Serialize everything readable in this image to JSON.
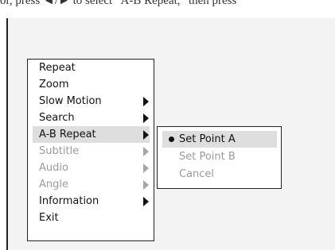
{
  "top_text": "or, press ◄/► to select “A-B Repeat,” then press",
  "main_menu": {
    "items": [
      {
        "label": "Repeat"
      },
      {
        "label": "Zoom"
      },
      {
        "label": "Slow Motion",
        "arrow_icon": "triangle-right"
      },
      {
        "label": "Search",
        "arrow_icon": "triangle-right"
      },
      {
        "label": "A-B Repeat",
        "arrow_icon": "triangle-right",
        "state": "selected"
      },
      {
        "label": "Subtitle",
        "arrow_icon": "triangle-right",
        "state": "disabled"
      },
      {
        "label": "Audio",
        "arrow_icon": "triangle-right",
        "state": "disabled"
      },
      {
        "label": "Angle",
        "arrow_icon": "triangle-right",
        "state": "disabled"
      },
      {
        "label": "Information",
        "arrow_icon": "triangle-right"
      },
      {
        "label": "Exit"
      }
    ]
  },
  "submenu": {
    "items": [
      {
        "label": "Set Point A",
        "bullet_icon": "filled-circle",
        "state": "selected"
      },
      {
        "label": "Set Point B",
        "state": "disabled"
      },
      {
        "label": "Cancel",
        "state": "disabled"
      }
    ]
  }
}
